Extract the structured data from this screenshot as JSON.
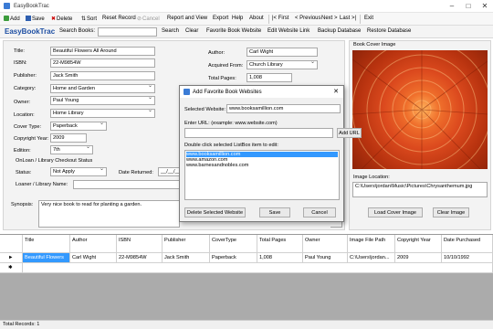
{
  "window": {
    "title": "EasyBookTrac"
  },
  "menu": {
    "add": "Add",
    "save": "Save",
    "delete": "Delete",
    "sort": "Sort",
    "reset": "Reset Record",
    "cancel": "Cancel",
    "report": "Report and View",
    "export": "Export",
    "help": "Help",
    "about": "About",
    "first": "|< First",
    "previous": "< Previous",
    "next": "Next >",
    "last": "Last >|",
    "exit": "Exit"
  },
  "toolbar": {
    "brand": "EasyBookTrac",
    "search_label": "Search Books:",
    "search_value": "",
    "search": "Search",
    "clear": "Clear",
    "fav_site": "Favorite Book Website",
    "edit_link": "Edit Website Link",
    "backup": "Backup Database",
    "restore": "Restore Database"
  },
  "form": {
    "title_label": "Title:",
    "title": "Beautiful Flowers All Around",
    "isbn_label": "ISBN:",
    "isbn": "22-M9854W",
    "publisher_label": "Publisher:",
    "publisher": "Jack Smith",
    "category_label": "Category:",
    "category": "Home and Garden",
    "owner_label": "Owner:",
    "owner": "Paul Young",
    "location_label": "Location:",
    "location": "Home Library",
    "cover_label": "Cover Type:",
    "cover": "Paperback",
    "year_label": "Copyright Year:",
    "year": "2009",
    "edition_label": "Edition:",
    "edition": "7th",
    "author_label": "Author:",
    "author": "Carl Wight",
    "acquired_label": "Acquired From:",
    "acquired": "Church Library",
    "pages_label": "Total Pages:",
    "pages": "1,008",
    "loan_header": "OnLoan / Library Checkout Status",
    "status_label": "Status:",
    "status": "Not Apply",
    "returned_label": "Date Returned:",
    "returned": "__/__/____",
    "loaner_label": "Loaner / Library Name:",
    "loaner": "",
    "synopsis_label": "Synopsis:",
    "synopsis": "Very nice book to read for planting a garden."
  },
  "cover_panel": {
    "header": "Book Cover Image",
    "location_label": "Image Location:",
    "location": "C:\\Users\\jordan\\Music\\Pictures\\Chrysanthemum.jpg",
    "load": "Load Cover Image",
    "clear": "Clear Image"
  },
  "dialog": {
    "title": "Add Favorite Book Websites",
    "selected_label": "Selected Website:",
    "selected": "www.booksamillion.com",
    "url_label": "Enter URL: (example: www.website.com)",
    "url": "",
    "add": "Add URL",
    "list_label": "Double click selected ListBox item to edit:",
    "items": [
      "www.booksamillion.com",
      "www.amazon.com",
      "www.barnesandnobles.com"
    ],
    "delete": "Delete Selected Website",
    "save": "Save",
    "cancel": "Cancel"
  },
  "grid": {
    "headers": [
      "Title",
      "Author",
      "ISBN",
      "Publisher",
      "CoverType",
      "Total Pages",
      "Owner",
      "Image File Path",
      "Copyright Year",
      "Date Purchased"
    ],
    "row": [
      "Beautiful Flowers",
      "Carl Wight",
      "22-M9854W",
      "Jack Smith",
      "Paperback",
      "1,008",
      "Paul Young",
      "C:\\Users\\jordan...",
      "2009",
      "10/10/1992"
    ]
  },
  "status": {
    "total": "Total Records: 1"
  },
  "colors": {
    "brand": "#1e4fa3",
    "selection": "#3399ff",
    "accent_flower": "#e2572a"
  }
}
